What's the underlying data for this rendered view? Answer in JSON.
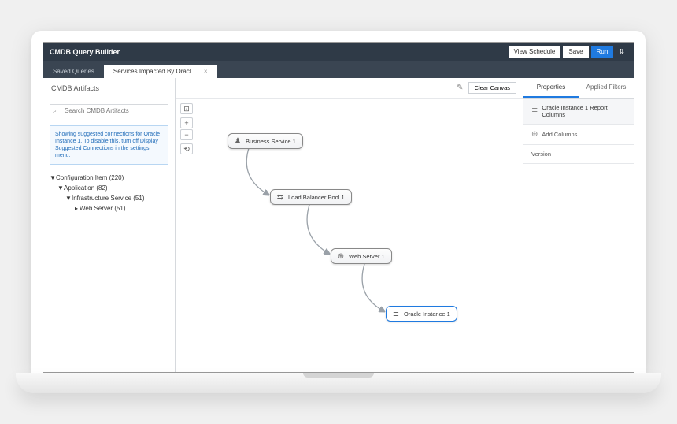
{
  "title": "CMDB Query Builder",
  "toolbar": {
    "viewSchedule": "View Schedule",
    "save": "Save",
    "run": "Run"
  },
  "tabs": {
    "saved": "Saved Queries",
    "active": "Services Impacted By Oracl…"
  },
  "sidebar": {
    "title": "CMDB Artifacts",
    "searchPlaceholder": "Search CMDB Artifacts",
    "message": "Showing suggested connections for Oracle Instance 1. To disable this, turn off Display Suggested Connections in the settings menu.",
    "tree": {
      "ci": "Configuration Item (220)",
      "app": "Application (82)",
      "infra": "Infrastructure Service (51)",
      "ws": "Web Server (51)"
    }
  },
  "canvas": {
    "clear": "Clear Canvas",
    "nodes": {
      "n1": "Business Service 1",
      "n2": "Load Balancer Pool 1",
      "n3": "Web Server 1",
      "n4": "Oracle Instance 1"
    }
  },
  "right": {
    "tabProperties": "Properties",
    "tabFilters": "Applied Filters",
    "headerTitle": "Oracle Instance 1 Report Columns",
    "addColumns": "Add Columns",
    "version": "Version"
  }
}
